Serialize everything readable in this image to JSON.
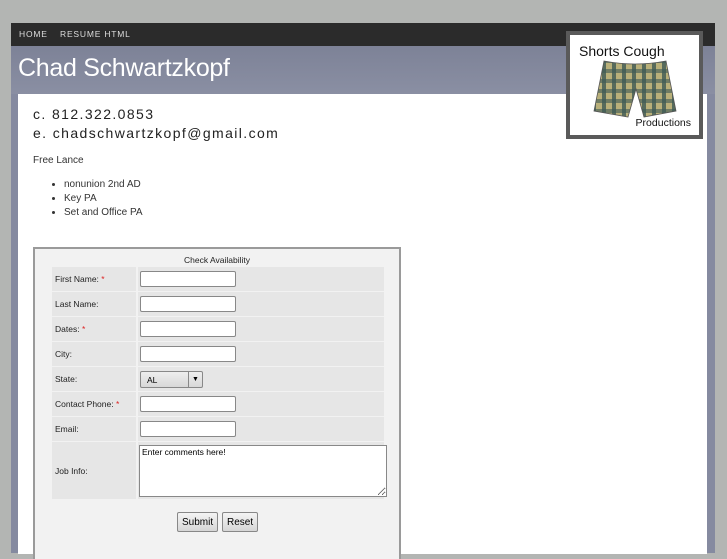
{
  "nav": {
    "items": [
      {
        "label": "HOME"
      },
      {
        "label": "RESUME HTML"
      }
    ]
  },
  "header": {
    "title": "Chad Schwartzkopf"
  },
  "logo": {
    "line1": "Shorts Cough",
    "line2": "Productions"
  },
  "contact": {
    "phone": "c. 812.322.0853",
    "email": "e. chadschwartzkopf@gmail.com"
  },
  "intro": "Free Lance",
  "skills": [
    "nonunion 2nd AD",
    "Key PA",
    "Set and Office PA"
  ],
  "form": {
    "title": "Check Availability",
    "required_mark": "*",
    "fields": [
      {
        "label": "First Name:",
        "required": true,
        "value": ""
      },
      {
        "label": "Last Name:",
        "required": false,
        "value": ""
      },
      {
        "label": "Dates:",
        "required": true,
        "value": ""
      },
      {
        "label": "City:",
        "required": false,
        "value": ""
      },
      {
        "label": "State:",
        "required": false,
        "value": "AL"
      },
      {
        "label": "Contact Phone:",
        "required": true,
        "value": ""
      },
      {
        "label": "Email:",
        "required": false,
        "value": ""
      },
      {
        "label": "Job Info:",
        "required": false,
        "value": "Enter comments here!"
      }
    ],
    "submit_label": "Submit",
    "reset_label": "Reset"
  },
  "colors": {
    "nav_bg": "#2b2b2b",
    "header_bg": "#858aa0",
    "required": "#dd2222"
  }
}
